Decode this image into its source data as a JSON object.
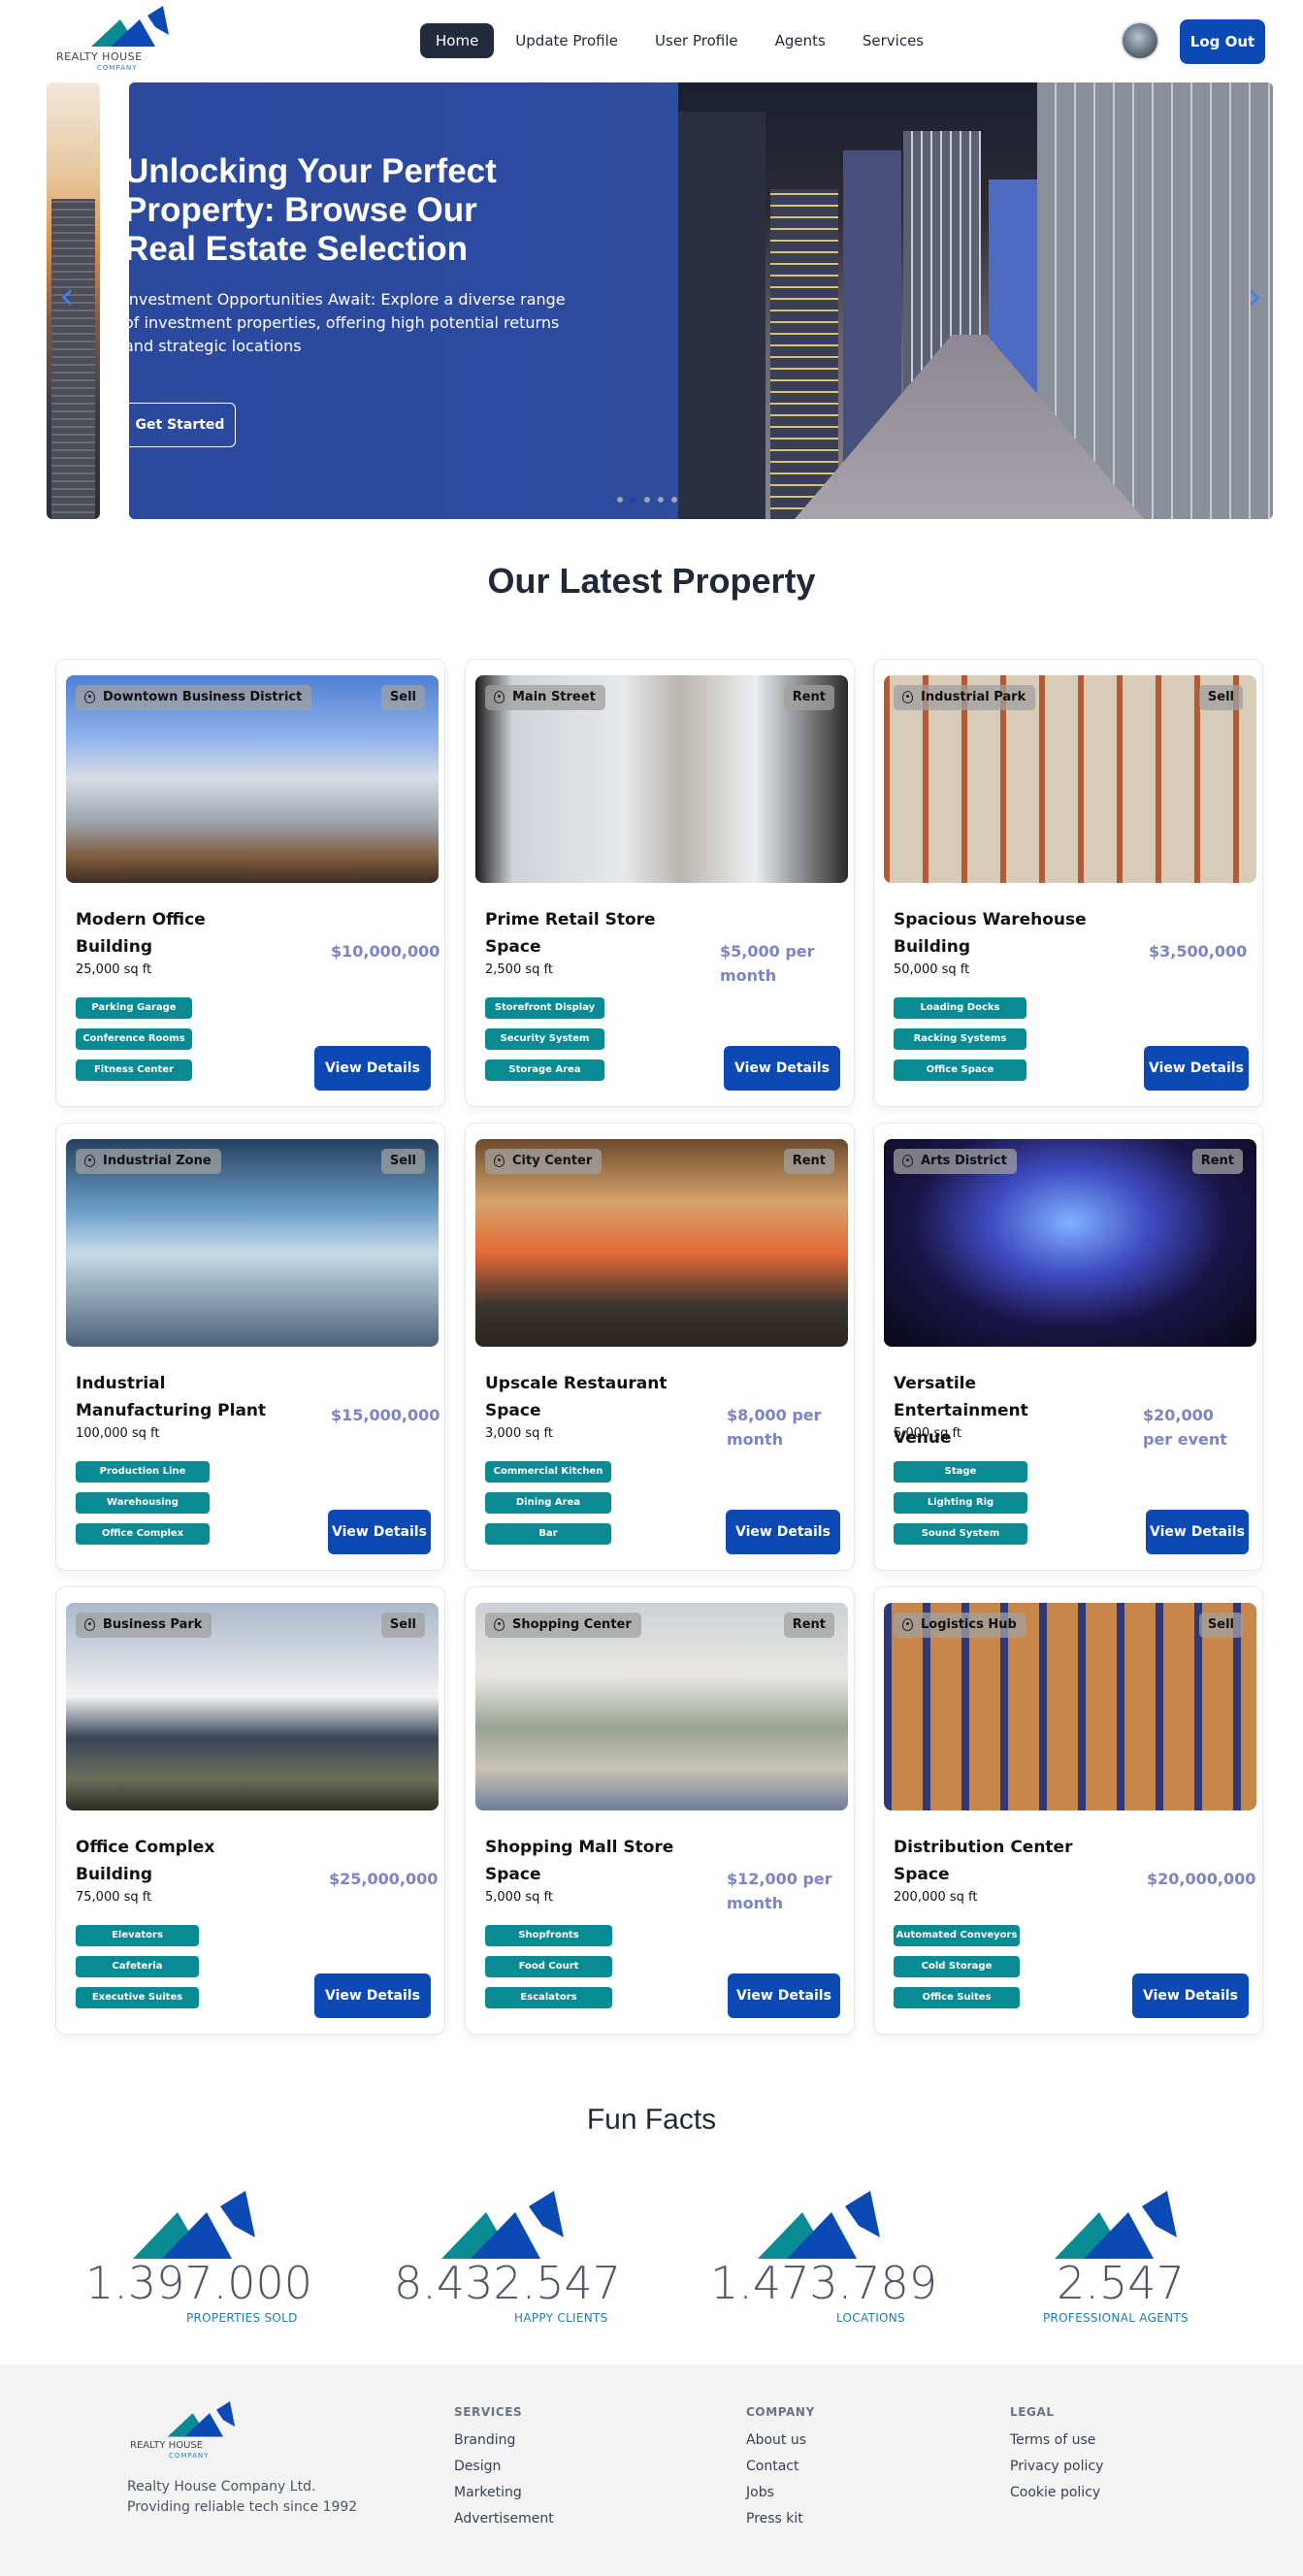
{
  "brand": {
    "name": "REALTY HOUSE",
    "sub": "COMPANY"
  },
  "nav": {
    "items": [
      "Home",
      "Update Profile",
      "User Profile",
      "Agents",
      "Services"
    ],
    "active": 0,
    "logout": "Log Out"
  },
  "hero": {
    "title": "Unlocking Your Perfect Property: Browse Our Real Estate Selection",
    "text_line1": "Investment Opportunities Await: Explore a diverse range of investment properties, offering high potential returns",
    "text_line2": "and strategic locations",
    "cta": "Get Started",
    "slides": 5,
    "active_slide": 1
  },
  "properties_title": "Our Latest Property",
  "properties": [
    {
      "location": "Downtown Business District",
      "type": "Sell",
      "name": "Modern Office Building",
      "area": "25,000 sq ft",
      "price": "$10,000,000",
      "features": [
        "Parking Garage",
        "Conference Rooms",
        "Fitness Center"
      ],
      "button": "View Details"
    },
    {
      "location": "Main Street",
      "type": "Rent",
      "name": "Prime Retail Store Space",
      "area": "2,500 sq ft",
      "price": "$5,000 per month",
      "features": [
        "Storefront Display",
        "Security System",
        "Storage Area"
      ],
      "button": "View Details"
    },
    {
      "location": "Industrial Park",
      "type": "Sell",
      "name": "Spacious Warehouse Building",
      "area": "50,000 sq ft",
      "price": "$3,500,000",
      "features": [
        "Loading Docks",
        "Racking Systems",
        "Office Space"
      ],
      "button": "View Details"
    },
    {
      "location": "Industrial Zone",
      "type": "Sell",
      "name": "Industrial Manufacturing Plant",
      "area": "100,000 sq ft",
      "price": "$15,000,000",
      "features": [
        "Production Line",
        "Warehousing",
        "Office Complex"
      ],
      "button": "View Details"
    },
    {
      "location": "City Center",
      "type": "Rent",
      "name": "Upscale Restaurant Space",
      "area": "3,000 sq ft",
      "price": "$8,000 per month",
      "features": [
        "Commercial Kitchen",
        "Dining Area",
        "Bar"
      ],
      "button": "View Details"
    },
    {
      "location": "Arts District",
      "type": "Rent",
      "name": "Versatile Entertainment Venue",
      "area": "5,000 sq ft",
      "price": "$20,000 per event",
      "features": [
        "Stage",
        "Lighting Rig",
        "Sound System"
      ],
      "button": "View Details"
    },
    {
      "location": "Business Park",
      "type": "Sell",
      "name": "Office Complex Building",
      "area": "75,000 sq ft",
      "price": "$25,000,000",
      "features": [
        "Elevators",
        "Cafeteria",
        "Executive Suites"
      ],
      "button": "View Details"
    },
    {
      "location": "Shopping Center",
      "type": "Rent",
      "name": "Shopping Mall Store Space",
      "area": "5,000 sq ft",
      "price": "$12,000 per month",
      "features": [
        "Shopfronts",
        "Food Court",
        "Escalators"
      ],
      "button": "View Details"
    },
    {
      "location": "Logistics Hub",
      "type": "Sell",
      "name": "Distribution Center Space",
      "area": "200,000 sq ft",
      "price": "$20,000,000",
      "features": [
        "Automated Conveyors",
        "Cold Storage",
        "Office Suites"
      ],
      "button": "View Details"
    }
  ],
  "facts_title": "Fun Facts",
  "facts": [
    {
      "value": "1.397.000",
      "label": "PROPERTIES SOLD"
    },
    {
      "value": "8.432.547",
      "label": "HAPPY CLIENTS"
    },
    {
      "value": "1.473.789",
      "label": "LOCATIONS"
    },
    {
      "value": "2.547",
      "label": "PROFESSIONAL AGENTS"
    }
  ],
  "footer": {
    "company_name": "Realty House Company Ltd.",
    "tagline": "Providing reliable tech since 1992",
    "columns": [
      {
        "title": "SERVICES",
        "links": [
          "Branding",
          "Design",
          "Marketing",
          "Advertisement"
        ]
      },
      {
        "title": "COMPANY",
        "links": [
          "About us",
          "Contact",
          "Jobs",
          "Press kit"
        ]
      },
      {
        "title": "LEGAL",
        "links": [
          "Terms of use",
          "Privacy policy",
          "Cookie policy"
        ]
      }
    ]
  },
  "colors": {
    "primary": "#0b49b5",
    "teal": "#0a8b94",
    "price": "#7b84c4",
    "dark": "#222b3c"
  }
}
